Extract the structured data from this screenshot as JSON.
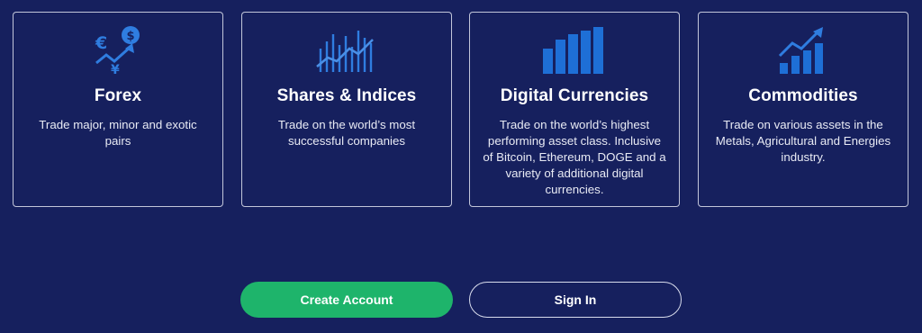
{
  "colors": {
    "background": "#16205e",
    "accent_blue": "#1e6fd6",
    "primary_green": "#1eb46b"
  },
  "cards": [
    {
      "icon": "currency-exchange-icon",
      "title": "Forex",
      "description": "Trade major, minor and exotic pairs"
    },
    {
      "icon": "candlestick-chart-icon",
      "title": "Shares & Indices",
      "description": "Trade on the world’s most successful companies"
    },
    {
      "icon": "bar-chart-icon",
      "title": "Digital Currencies",
      "description": "Trade on the world’s highest performing asset class. Inclusive of Bitcoin, Ethereum, DOGE and a variety of additional digital currencies."
    },
    {
      "icon": "growth-chart-icon",
      "title": "Commodities",
      "description": "Trade on various assets in the Metals, Agricultural and Energies industry."
    }
  ],
  "actions": {
    "create_account": "Create Account",
    "sign_in": "Sign In"
  }
}
